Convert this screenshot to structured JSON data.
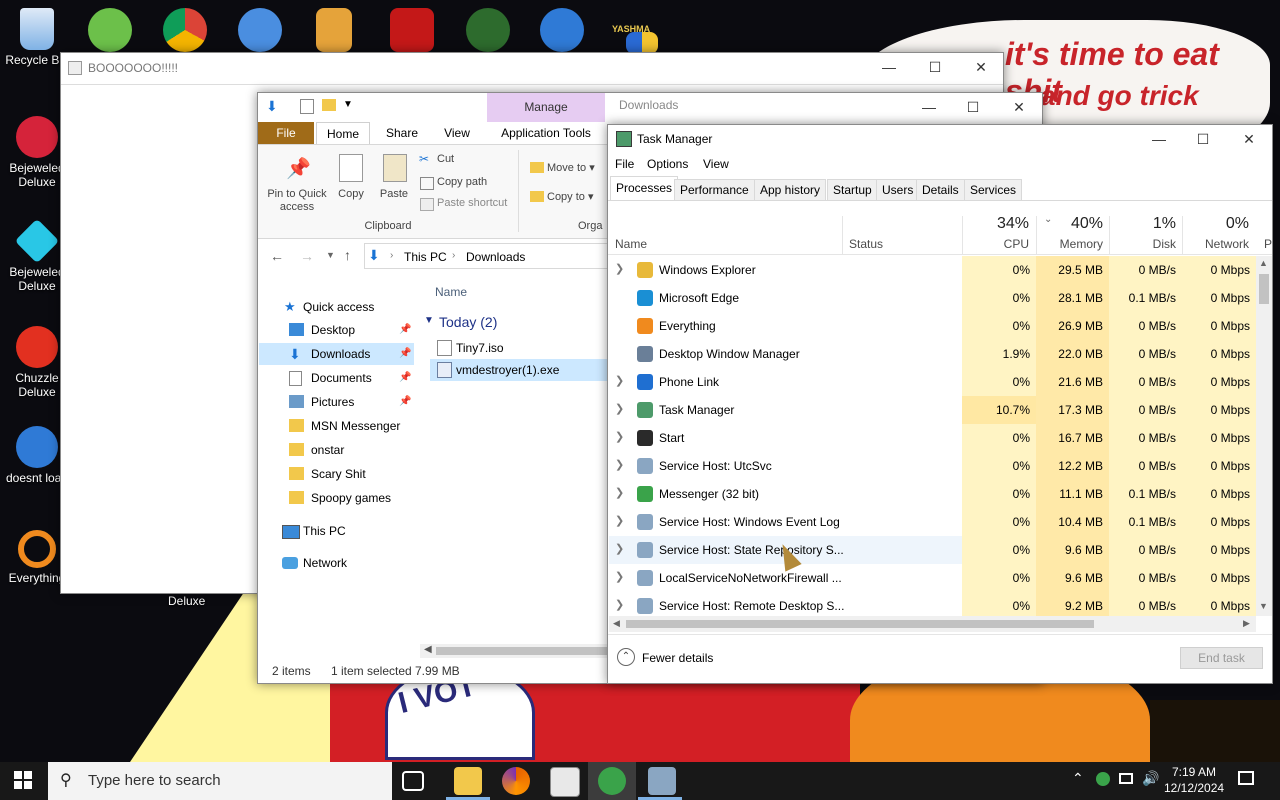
{
  "desktop": {
    "wallpaper_text": {
      "line1": "it's time to eat shit",
      "line2": "and go trick",
      "vote": "I VOT"
    },
    "icons": [
      {
        "label": "Recycle Bin",
        "color": "#7fb2e5"
      },
      {
        "label": "Bejeweled Deluxe",
        "color": "#d5233a"
      },
      {
        "label": "Bejeweled Deluxe",
        "color": "#29c7e6"
      },
      {
        "label": "Chuzzle Deluxe",
        "color": "#e23020"
      },
      {
        "label": "doesnt load",
        "color": "#2f7ad6"
      },
      {
        "label": "Everything",
        "color": "#f08a1e"
      }
    ],
    "under_window_label": "Deluxe",
    "yashma_label": "YASHMA"
  },
  "booo_window": {
    "title": "BOOOOOOO!!!!!"
  },
  "explorer": {
    "qat_label": "Manage",
    "title": "Downloads",
    "ribbon_tabs": [
      "File",
      "Home",
      "Share",
      "View",
      "Application Tools"
    ],
    "clipboard": {
      "pin_label": "Pin to Quick access",
      "copy": "Copy",
      "paste": "Paste",
      "cut": "Cut",
      "copy_path": "Copy path",
      "paste_shortcut": "Paste shortcut",
      "group": "Clipboard"
    },
    "organize": {
      "move_to": "Move to",
      "copy_to": "Copy to",
      "group": "Orga"
    },
    "breadcrumb": [
      "This PC",
      "Downloads"
    ],
    "nav": {
      "quick_access": "Quick access",
      "items": [
        "Desktop",
        "Downloads",
        "Documents",
        "Pictures",
        "MSN Messenger",
        "onstar",
        "Scary Shit",
        "Spoopy games"
      ],
      "this_pc": "This PC",
      "network": "Network"
    },
    "list": {
      "header_name": "Name",
      "group": "Today (2)",
      "files": [
        "Tiny7.iso",
        "vmdestroyer(1).exe"
      ]
    },
    "status": {
      "items": "2 items",
      "selected": "1 item selected",
      "size": "7.99 MB"
    }
  },
  "task_manager": {
    "title": "Task Manager",
    "menu": [
      "File",
      "Options",
      "View"
    ],
    "tabs": [
      "Processes",
      "Performance",
      "App history",
      "Startup",
      "Users",
      "Details",
      "Services"
    ],
    "columns": {
      "name": "Name",
      "status": "Status",
      "cpu": {
        "pct": "34%",
        "label": "CPU"
      },
      "memory": {
        "pct": "40%",
        "label": "Memory"
      },
      "disk": {
        "pct": "1%",
        "label": "Disk"
      },
      "network": {
        "pct": "0%",
        "label": "Network"
      },
      "overflow": "P"
    },
    "processes": [
      {
        "name": "Windows Explorer",
        "cpu": "0%",
        "memory": "29.5 MB",
        "disk": "0 MB/s",
        "network": "0 Mbps",
        "expand": true,
        "color": "#e8b93a"
      },
      {
        "name": "Microsoft Edge",
        "cpu": "0%",
        "memory": "28.1 MB",
        "disk": "0.1 MB/s",
        "network": "0 Mbps",
        "expand": false,
        "color": "#1a8fd4"
      },
      {
        "name": "Everything",
        "cpu": "0%",
        "memory": "26.9 MB",
        "disk": "0 MB/s",
        "network": "0 Mbps",
        "expand": false,
        "color": "#f08a1e"
      },
      {
        "name": "Desktop Window Manager",
        "cpu": "1.9%",
        "memory": "22.0 MB",
        "disk": "0 MB/s",
        "network": "0 Mbps",
        "expand": false,
        "color": "#6a7f98"
      },
      {
        "name": "Phone Link",
        "cpu": "0%",
        "memory": "21.6 MB",
        "disk": "0 MB/s",
        "network": "0 Mbps",
        "expand": true,
        "color": "#1f6fd1"
      },
      {
        "name": "Task Manager",
        "cpu": "10.7%",
        "memory": "17.3 MB",
        "disk": "0 MB/s",
        "network": "0 Mbps",
        "expand": true,
        "color": "#4d9a6a"
      },
      {
        "name": "Start",
        "cpu": "0%",
        "memory": "16.7 MB",
        "disk": "0 MB/s",
        "network": "0 Mbps",
        "expand": true,
        "color": "#2a2a2a"
      },
      {
        "name": "Service Host: UtcSvc",
        "cpu": "0%",
        "memory": "12.2 MB",
        "disk": "0 MB/s",
        "network": "0 Mbps",
        "expand": true,
        "color": "#8aa6c2"
      },
      {
        "name": "Messenger (32 bit)",
        "cpu": "0%",
        "memory": "11.1 MB",
        "disk": "0.1 MB/s",
        "network": "0 Mbps",
        "expand": true,
        "color": "#3aa34a"
      },
      {
        "name": "Service Host: Windows Event Log",
        "cpu": "0%",
        "memory": "10.4 MB",
        "disk": "0.1 MB/s",
        "network": "0 Mbps",
        "expand": true,
        "color": "#8aa6c2"
      },
      {
        "name": "Service Host: State Repository S...",
        "cpu": "0%",
        "memory": "9.6 MB",
        "disk": "0 MB/s",
        "network": "0 Mbps",
        "expand": true,
        "color": "#8aa6c2"
      },
      {
        "name": "LocalServiceNoNetworkFirewall ...",
        "cpu": "0%",
        "memory": "9.6 MB",
        "disk": "0 MB/s",
        "network": "0 Mbps",
        "expand": true,
        "color": "#8aa6c2"
      },
      {
        "name": "Service Host: Remote Desktop S...",
        "cpu": "0%",
        "memory": "9.2 MB",
        "disk": "0 MB/s",
        "network": "0 Mbps",
        "expand": true,
        "color": "#8aa6c2"
      }
    ],
    "fewer_details": "Fewer details",
    "end_task": "End task"
  },
  "taskbar": {
    "search_placeholder": "Type here to search",
    "time": "7:19 AM",
    "date": "12/12/2024"
  },
  "colors": {
    "cpu_heat_low": "#fff4c4",
    "cpu_heat_high": "#ffe8a3",
    "mem_heat": "#ffe9a8",
    "explorer_file_tab": "#a06b18",
    "manage_tab": "#e6ccf2",
    "selection": "#cce8ff"
  }
}
